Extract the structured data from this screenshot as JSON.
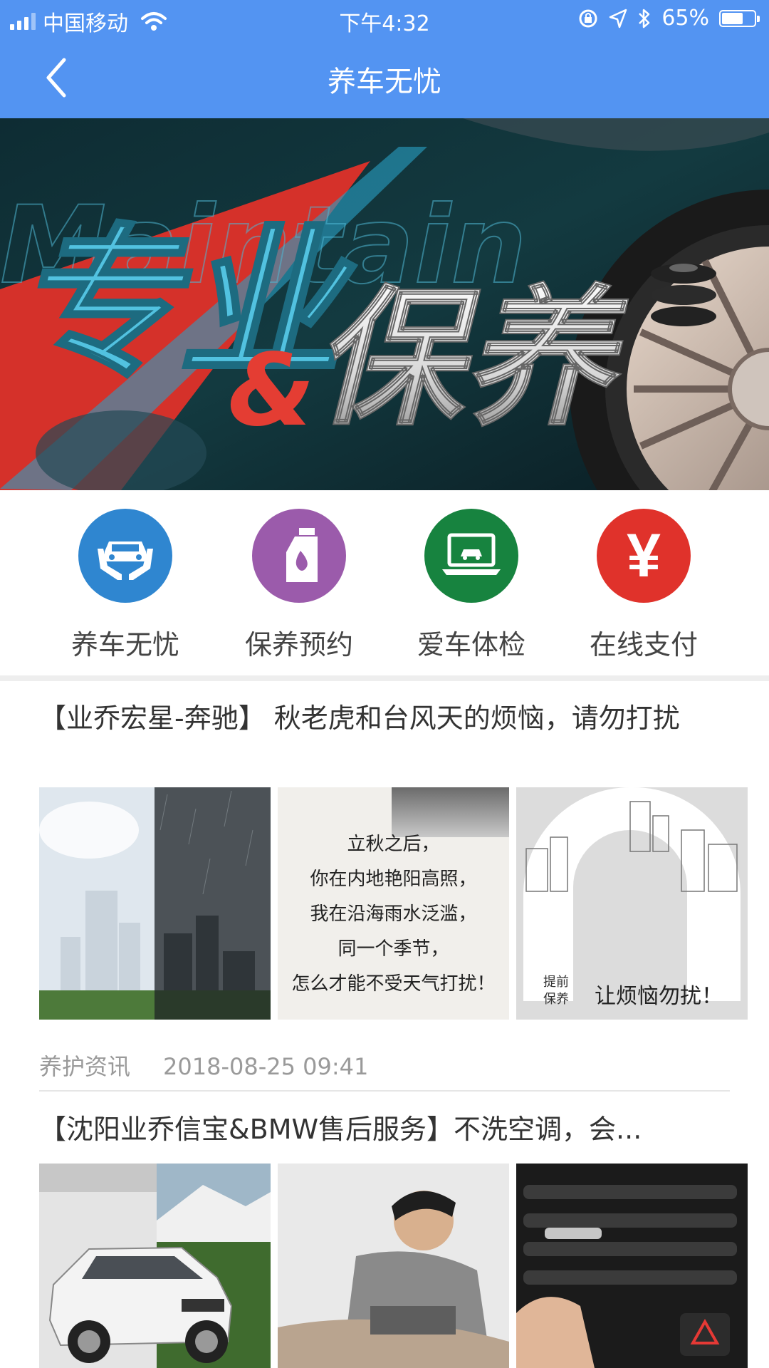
{
  "status_bar": {
    "carrier": "中国移动",
    "time": "下午4:32",
    "battery": "65%",
    "battery_level": 0.65
  },
  "nav": {
    "title": "养车无忧"
  },
  "banner": {
    "main_text_1": "专业",
    "amp": "&",
    "main_text_2": "保养",
    "bg_text": "Maintain"
  },
  "actions": [
    {
      "label": "养车无忧",
      "icon": "car-care-hands-icon",
      "color": "#2f86d0"
    },
    {
      "label": "保养预约",
      "icon": "oil-bottle-icon",
      "color": "#9b5bab"
    },
    {
      "label": "爱车体检",
      "icon": "laptop-car-icon",
      "color": "#17833f"
    },
    {
      "label": "在线支付",
      "icon": "yuan-icon",
      "color": "#e0322b",
      "symbol": "¥"
    }
  ],
  "articles": [
    {
      "title": "【业乔宏星-奔驰】 秋老虎和台风天的烦恼，请勿打扰",
      "category": "养护资讯",
      "date": "2018-08-25 09:41",
      "thumb2_lines": [
        "立秋之后，",
        "你在内地艳阳高照，",
        "我在沿海雨水泛滥，",
        "同一个季节，",
        "怎么才能不受天气打扰！"
      ],
      "thumb3_small_1": "提前",
      "thumb3_small_2": "保养",
      "thumb3_caption": "让烦恼勿扰！"
    },
    {
      "title": "【沈阳业乔信宝&BMW售后服务】不洗空调，会..."
    }
  ]
}
